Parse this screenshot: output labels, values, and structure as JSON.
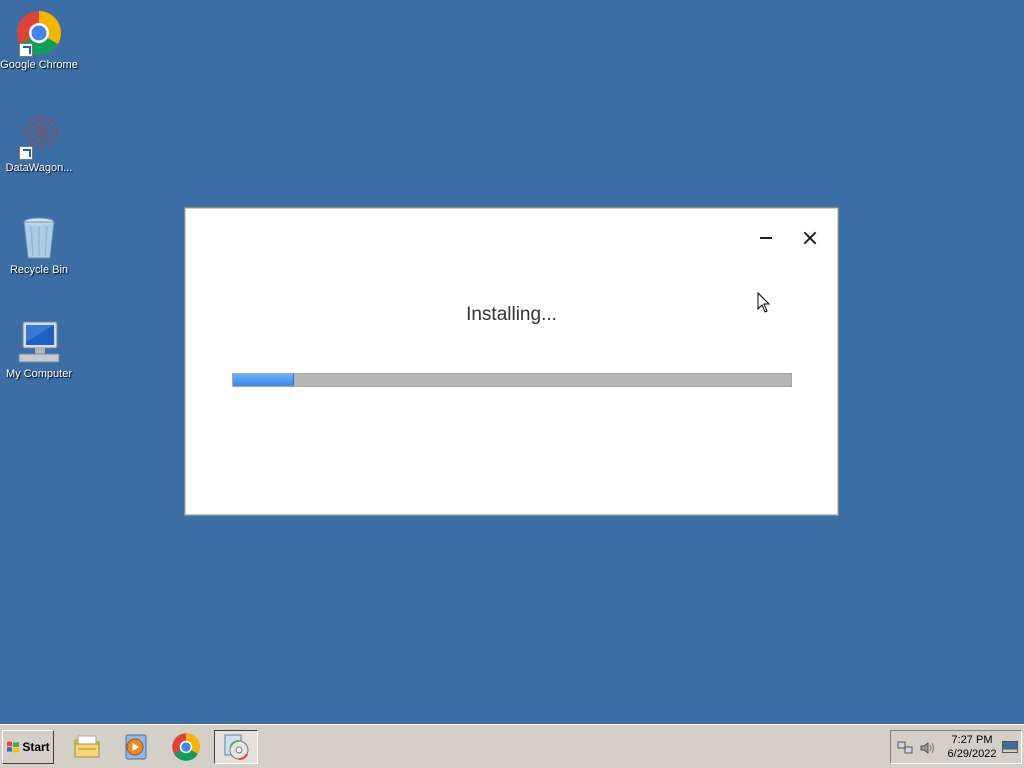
{
  "desktop": {
    "icons": [
      {
        "label": "Google Chrome",
        "icon": "chrome-icon",
        "shortcut": true
      },
      {
        "label": "DataWagon...",
        "icon": "datawagon-icon",
        "shortcut": true
      },
      {
        "label": "Recycle Bin",
        "icon": "recycle-bin-icon",
        "shortcut": false
      },
      {
        "label": "My Computer",
        "icon": "my-computer-icon",
        "shortcut": false
      }
    ]
  },
  "installer": {
    "status": "Installing...",
    "progress": 0.11,
    "accent_color": "#3a88ec"
  },
  "taskbar": {
    "start_label": "Start",
    "apps": [
      {
        "icon": "file-explorer-icon"
      },
      {
        "icon": "media-player-icon"
      },
      {
        "icon": "chrome-icon"
      },
      {
        "icon": "installer-app-icon",
        "active": true
      }
    ],
    "clock": {
      "time": "7:27 PM",
      "date": "6/29/2022"
    }
  },
  "colors": {
    "desktop_background": "#3a6ea5",
    "taskbar": "#d4d0c8"
  }
}
